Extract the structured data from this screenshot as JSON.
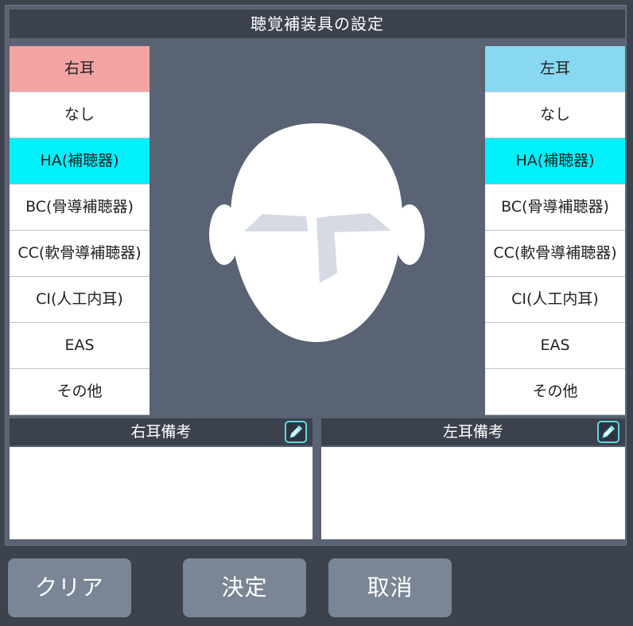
{
  "title": "聴覚補装具の設定",
  "right_ear": {
    "header": "右耳",
    "options": [
      {
        "label": "なし",
        "selected": false
      },
      {
        "label": "HA(補聴器)",
        "selected": true
      },
      {
        "label": "BC(骨導補聴器)",
        "selected": false
      },
      {
        "label": "CC(軟骨導補聴器)",
        "selected": false
      },
      {
        "label": "CI(人工内耳)",
        "selected": false
      },
      {
        "label": "EAS",
        "selected": false
      },
      {
        "label": "その他",
        "selected": false
      }
    ]
  },
  "left_ear": {
    "header": "左耳",
    "options": [
      {
        "label": "なし",
        "selected": false
      },
      {
        "label": "HA(補聴器)",
        "selected": true
      },
      {
        "label": "BC(骨導補聴器)",
        "selected": false
      },
      {
        "label": "CC(軟骨導補聴器)",
        "selected": false
      },
      {
        "label": "CI(人工内耳)",
        "selected": false
      },
      {
        "label": "EAS",
        "selected": false
      },
      {
        "label": "その他",
        "selected": false
      }
    ]
  },
  "memo": {
    "right": {
      "label": "右耳備考",
      "value": ""
    },
    "left": {
      "label": "左耳備考",
      "value": ""
    }
  },
  "buttons": {
    "clear": "クリア",
    "confirm": "決定",
    "cancel": "取消"
  },
  "icons": {
    "memo_edit": "pencil-icon",
    "face": "face-illustration"
  },
  "colors": {
    "right_ear_header": "#f4a3a3",
    "left_ear_header": "#88d8f2",
    "selected": "#00f0fc",
    "accent": "#5fd6e0"
  }
}
